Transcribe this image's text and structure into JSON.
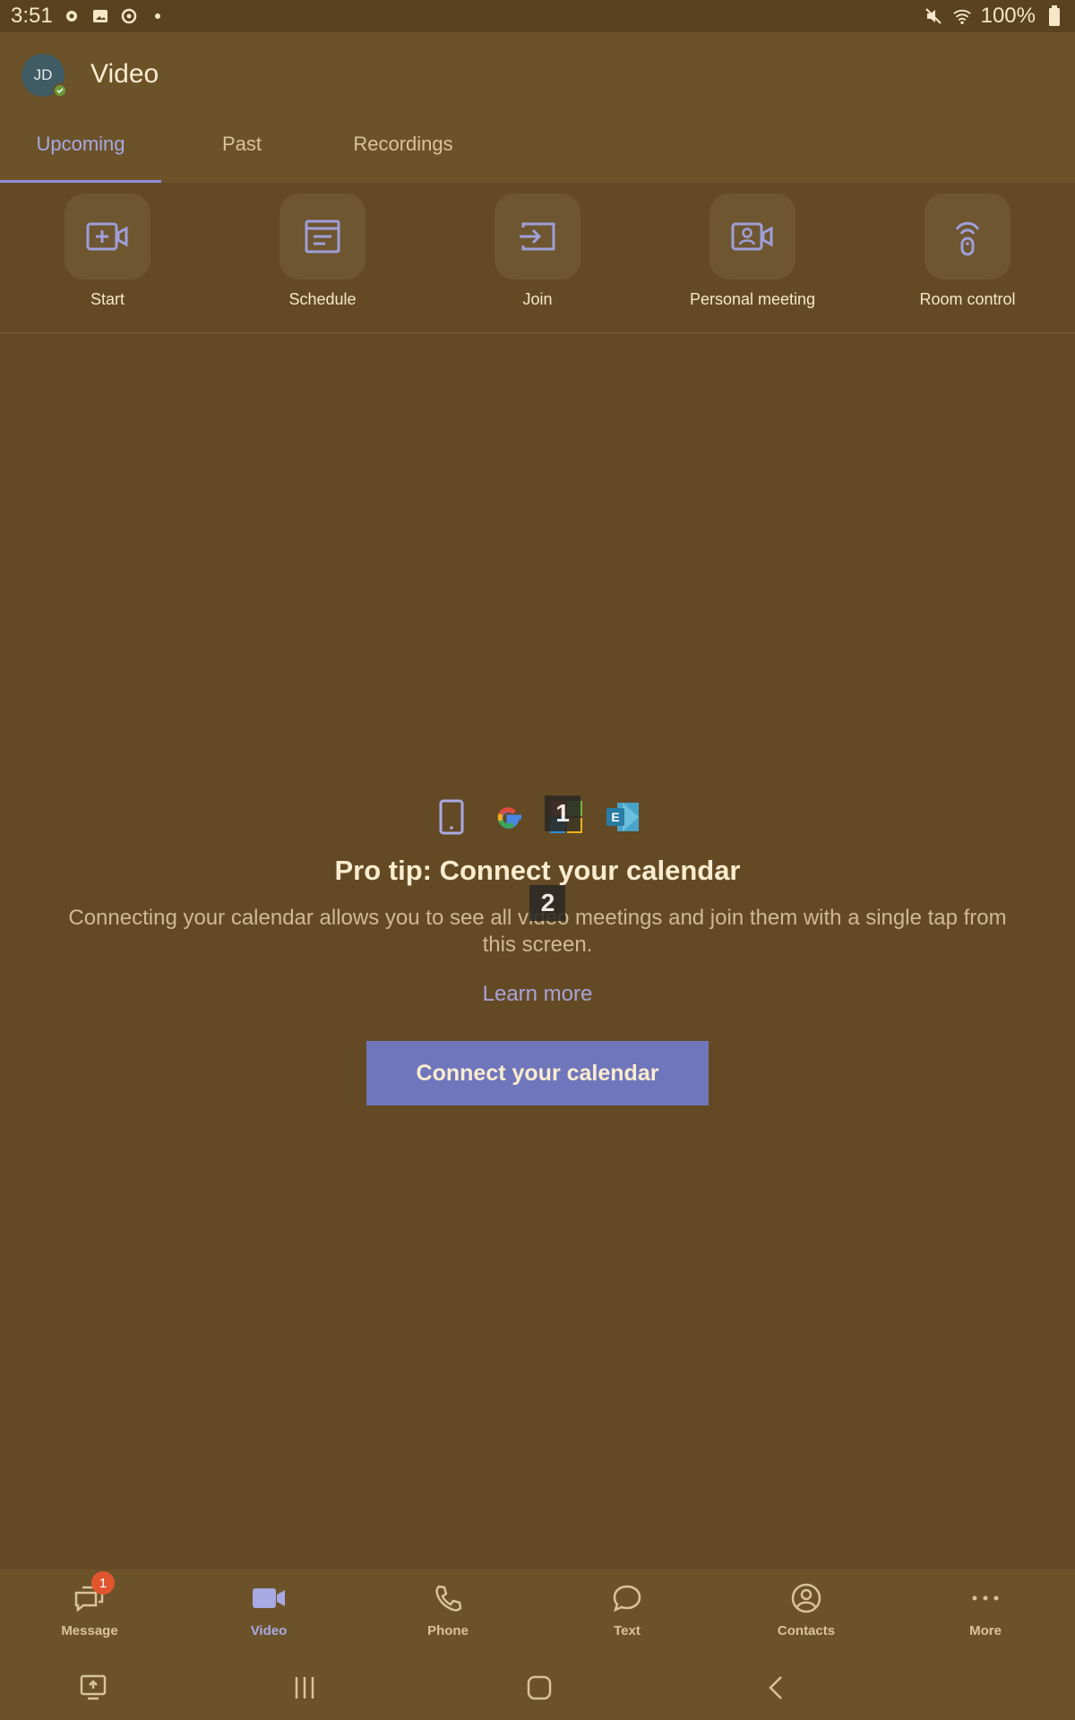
{
  "status_bar": {
    "time": "3:51",
    "battery": "100%",
    "icons": [
      "gear-icon",
      "photo-icon",
      "settings-icon",
      "dot-icon",
      "mute-icon",
      "wifi-icon",
      "battery-icon"
    ]
  },
  "header": {
    "avatar_initials": "JD",
    "title": "Video"
  },
  "tabs": [
    {
      "label": "Upcoming",
      "active": true
    },
    {
      "label": "Past",
      "active": false
    },
    {
      "label": "Recordings",
      "active": false
    }
  ],
  "actions": [
    {
      "label": "Start",
      "icon": "video-add-icon"
    },
    {
      "label": "Schedule",
      "icon": "calendar-list-icon"
    },
    {
      "label": "Join",
      "icon": "join-arrow-icon"
    },
    {
      "label": "Personal meeting",
      "icon": "personal-meeting-icon"
    },
    {
      "label": "Room control",
      "icon": "room-control-icon"
    }
  ],
  "promo": {
    "calendar_icons": [
      "phone-calendar-icon",
      "google-icon",
      "microsoft-icon",
      "exchange-icon"
    ],
    "markers": [
      "1",
      "2"
    ],
    "title": "Pro tip: Connect your calendar",
    "text": "Connecting your calendar allows you to see all video meetings and join them with a single tap from this screen.",
    "learn_more": "Learn more",
    "button": "Connect your calendar"
  },
  "bottom_nav": [
    {
      "label": "Message",
      "icon": "message-icon",
      "badge": "1",
      "active": false
    },
    {
      "label": "Video",
      "icon": "video-icon",
      "active": true
    },
    {
      "label": "Phone",
      "icon": "phone-icon",
      "active": false
    },
    {
      "label": "Text",
      "icon": "chat-bubble-icon",
      "active": false
    },
    {
      "label": "Contacts",
      "icon": "contacts-icon",
      "active": false
    },
    {
      "label": "More",
      "icon": "more-icon",
      "active": false
    }
  ],
  "colors": {
    "background": "#634a25",
    "header": "#6b5229",
    "accent": "#8f8fd8",
    "button": "#6f76bb",
    "badge": "#e0552e"
  }
}
